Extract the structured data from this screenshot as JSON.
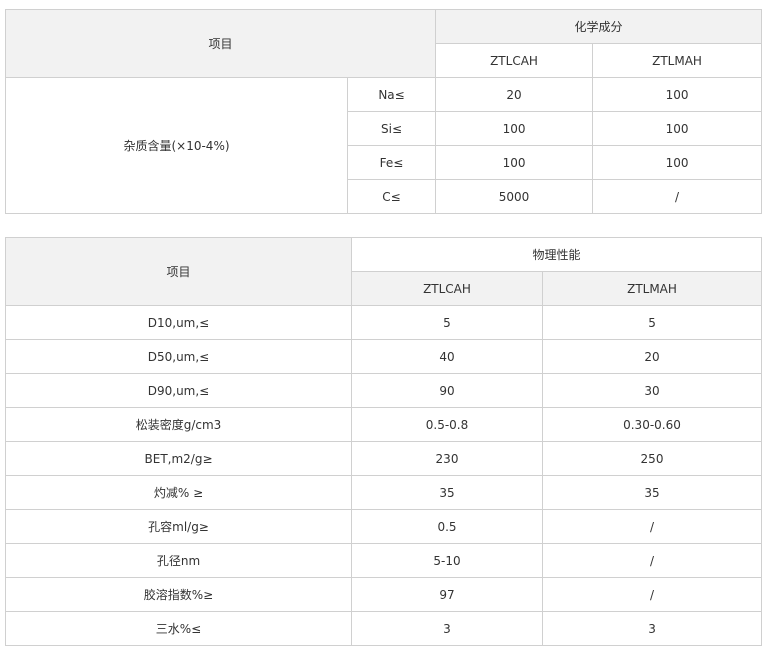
{
  "table1": {
    "header_item": "项目",
    "header_group": "化学成分",
    "col_a": "ZTLCAH",
    "col_b": "ZTLMAH",
    "row_group_label": "杂质含量(×10-4%)",
    "rows": [
      {
        "label": "Na≤",
        "a": "20",
        "b": "100"
      },
      {
        "label": "Si≤",
        "a": "100",
        "b": "100"
      },
      {
        "label": "Fe≤",
        "a": "100",
        "b": "100"
      },
      {
        "label": "C≤",
        "a": "5000",
        "b": "/"
      }
    ]
  },
  "table2": {
    "header_item": "项目",
    "header_group": "物理性能",
    "col_a": "ZTLCAH",
    "col_b": "ZTLMAH",
    "rows": [
      {
        "label": "D10,um,≤",
        "a": "5",
        "b": "5"
      },
      {
        "label": "D50,um,≤",
        "a": "40",
        "b": "20"
      },
      {
        "label": "D90,um,≤",
        "a": "90",
        "b": "30"
      },
      {
        "label": "松装密度g/cm3",
        "a": "0.5-0.8",
        "b": "0.30-0.60"
      },
      {
        "label": "BET,m2/g≥",
        "a": "230",
        "b": "250"
      },
      {
        "label": "灼减% ≥",
        "a": "35",
        "b": "35"
      },
      {
        "label": "孔容ml/g≥",
        "a": "0.5",
        "b": "/"
      },
      {
        "label": "孔径nm",
        "a": "5-10",
        "b": "/"
      },
      {
        "label": "胶溶指数%≥",
        "a": "97",
        "b": "/"
      },
      {
        "label": "三水%≤",
        "a": "3",
        "b": "3"
      }
    ]
  }
}
